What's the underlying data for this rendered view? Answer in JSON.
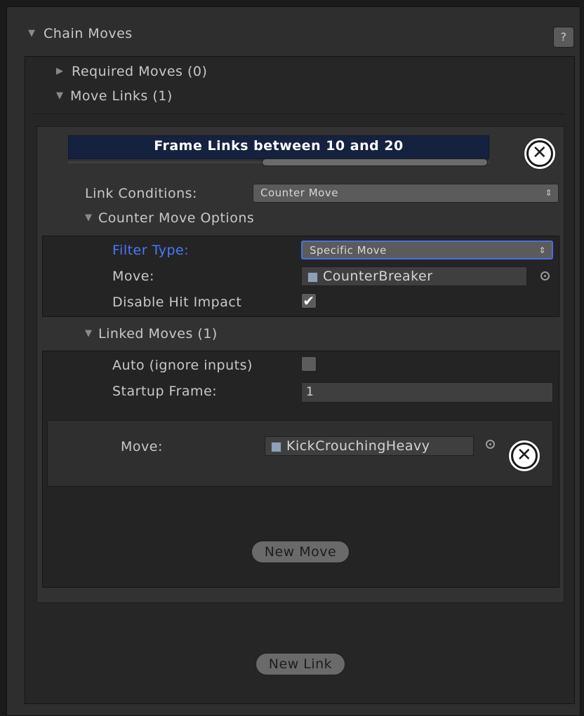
{
  "chain_moves": {
    "title": "Chain Moves",
    "help_label": "?",
    "required_moves_label": "Required Moves (0)",
    "move_links_label": "Move Links (1)"
  },
  "move_link": {
    "frame_range_label": "Frame Links between 10 and 20",
    "frame_range": {
      "min": 10,
      "max": 20
    },
    "remove_label": "✕",
    "link_conditions_label": "Link Conditions:",
    "link_conditions_value": "Counter Move",
    "counter_move_options_label": "Counter Move Options",
    "filter_type_label": "Filter Type:",
    "filter_type_value": "Specific Move",
    "move_label": "Move:",
    "move_value": "CounterBreaker",
    "disable_hit_impact_label": "Disable Hit Impact",
    "disable_hit_impact_checked": true,
    "linked_moves_label": "Linked Moves (1)",
    "auto_label": "Auto (ignore inputs)",
    "auto_checked": false,
    "startup_frame_label": "Startup Frame:",
    "startup_frame_value": "1",
    "linked_move_label": "Move:",
    "linked_move_value": "KickCrouchingHeavy",
    "new_move_label": "New Move"
  },
  "new_link_label": "New Link",
  "icons": {
    "expanded": "triangle-down-icon",
    "collapsed": "triangle-right-icon",
    "remove": "circle-x-icon",
    "picker": "object-picker-icon",
    "object": "move-asset-icon",
    "dropdown": "updown-arrows-icon"
  },
  "colors": {
    "background": "#2e2e2e",
    "accent_blue": "#4a78ff",
    "frame_range_bg": "#14213f"
  }
}
